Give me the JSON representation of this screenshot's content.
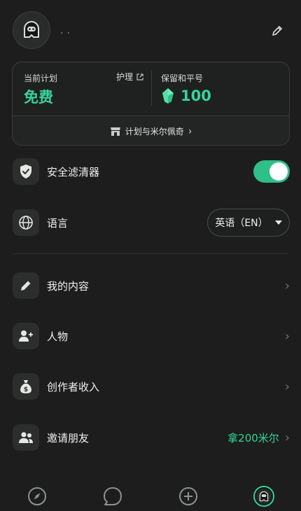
{
  "header": {
    "username": ". .",
    "avatar_icon": "ghost-avatar-icon",
    "edit_icon": "pencil-icon"
  },
  "plan": {
    "current_plan_label": "当前计划",
    "current_plan_value": "免费",
    "care_label": "护理",
    "reserve_label": "保留和平号",
    "reserve_value": "100",
    "reserve_icon": "green-gem-icon",
    "plans_link": "计划与米尔佩奇",
    "plans_icon": "store-icon"
  },
  "settings": {
    "safe_filter": {
      "label": "安全滤清器",
      "enabled": true,
      "icon": "shield-icon"
    },
    "language": {
      "label": "语言",
      "value": "英语（EN）",
      "icon": "globe-icon"
    }
  },
  "menu": [
    {
      "label": "我的内容",
      "icon": "pencil-icon"
    },
    {
      "label": "人物",
      "icon": "add-user-icon"
    },
    {
      "label": "创作者收入",
      "icon": "money-bag-icon"
    },
    {
      "label": "邀请朋友",
      "icon": "group-icon",
      "reward": "拿200米尔"
    }
  ],
  "nav": [
    {
      "name": "explore",
      "icon": "compass-icon"
    },
    {
      "name": "chat",
      "icon": "chat-bubble-icon"
    },
    {
      "name": "create",
      "icon": "plus-circle-icon"
    },
    {
      "name": "profile",
      "icon": "profile-avatar-icon",
      "active": true
    }
  ],
  "colors": {
    "accent": "#35d49a",
    "toggle_on": "#2fbf88",
    "background": "#1c1d1c"
  }
}
